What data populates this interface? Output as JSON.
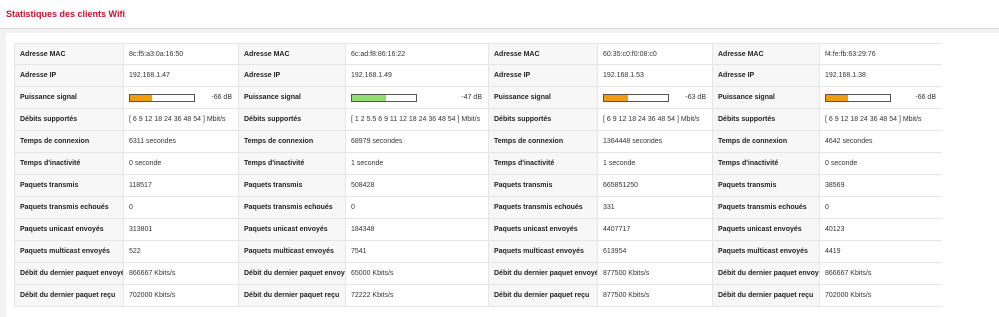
{
  "page": {
    "title": "Statistiques des clients Wifi"
  },
  "labels": {
    "mac": "Adresse MAC",
    "ip": "Adresse IP",
    "signal": "Puissance signal",
    "rates": "Débits supportés",
    "conn": "Temps de connexion",
    "idle": "Temps d'inactivité",
    "tx": "Paquets transmis",
    "tx_failed": "Paquets transmis echoués",
    "unicast": "Paquets unicast envoyés",
    "multicast": "Paquets multicast envoyés",
    "last_tx": "Débit du dernier paquet envoyé",
    "last_rx": "Débit du dernier paquet reçu"
  },
  "clients": [
    {
      "mac": "8c:f5:a3:0a:16:50",
      "ip": "192.168.1.47",
      "signal_text": "-66 dB",
      "signal_level": 0.34,
      "signal_color": "#f39c12",
      "rates": "[ 6 9 12 18 24 36 48 54 ] Mbit/s",
      "conn": "6311 secondes",
      "idle": "0 seconde",
      "tx": "118517",
      "tx_failed": "0",
      "unicast": "313801",
      "multicast": "522",
      "last_tx": "866667 Kbits/s",
      "last_rx": "702000 Kbits/s"
    },
    {
      "mac": "6c:ad:f8:86:16:22",
      "ip": "192.168.1.49",
      "signal_text": "-47 dB",
      "signal_level": 0.53,
      "signal_color": "#8fdc7a",
      "rates": "[ 1 2 5.5 6 9 11 12 18 24 36 48 54 ] Mbit/s",
      "conn": "68979 secondes",
      "idle": "1 seconde",
      "tx": "508428",
      "tx_failed": "0",
      "unicast": "184348",
      "multicast": "7541",
      "last_tx": "65000 Kbits/s",
      "last_rx": "72222 Kbits/s"
    },
    {
      "mac": "60:35:c0:f0:08:c0",
      "ip": "192.168.1.53",
      "signal_text": "-63 dB",
      "signal_level": 0.37,
      "signal_color": "#f39c12",
      "rates": "[ 6 9 12 18 24 36 48 54 ] Mbit/s",
      "conn": "1364448 secondes",
      "idle": "1 seconde",
      "tx": "665851250",
      "tx_failed": "331",
      "unicast": "4407717",
      "multicast": "613954",
      "last_tx": "877500 Kbits/s",
      "last_rx": "877500 Kbits/s"
    },
    {
      "mac": "f4:fe:fb:63:29:76",
      "ip": "192.168.1.38",
      "signal_text": "-66 dB",
      "signal_level": 0.34,
      "signal_color": "#f39c12",
      "rates": "[ 6 9 12 18 24 36 48 54 ] Mbit/s",
      "conn": "4642 secondes",
      "idle": "0 seconde",
      "tx": "38569",
      "tx_failed": "0",
      "unicast": "40123",
      "multicast": "4419",
      "last_tx": "866667 Kbits/s",
      "last_rx": "702000 Kbits/s"
    }
  ]
}
